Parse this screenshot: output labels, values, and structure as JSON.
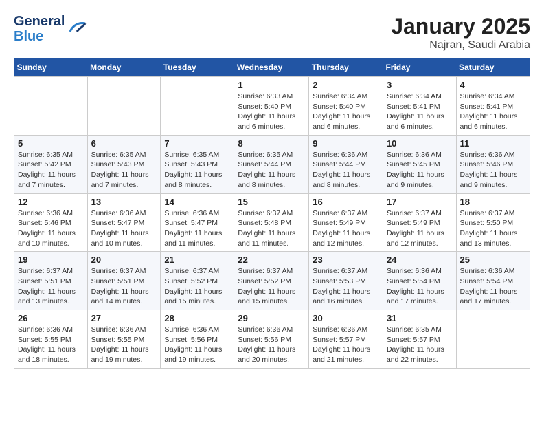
{
  "logo": {
    "line1": "General",
    "line2": "Blue"
  },
  "title": "January 2025",
  "subtitle": "Najran, Saudi Arabia",
  "weekdays": [
    "Sunday",
    "Monday",
    "Tuesday",
    "Wednesday",
    "Thursday",
    "Friday",
    "Saturday"
  ],
  "weeks": [
    [
      {
        "num": "",
        "info": ""
      },
      {
        "num": "",
        "info": ""
      },
      {
        "num": "",
        "info": ""
      },
      {
        "num": "1",
        "info": "Sunrise: 6:33 AM\nSunset: 5:40 PM\nDaylight: 11 hours\nand 6 minutes."
      },
      {
        "num": "2",
        "info": "Sunrise: 6:34 AM\nSunset: 5:40 PM\nDaylight: 11 hours\nand 6 minutes."
      },
      {
        "num": "3",
        "info": "Sunrise: 6:34 AM\nSunset: 5:41 PM\nDaylight: 11 hours\nand 6 minutes."
      },
      {
        "num": "4",
        "info": "Sunrise: 6:34 AM\nSunset: 5:41 PM\nDaylight: 11 hours\nand 6 minutes."
      }
    ],
    [
      {
        "num": "5",
        "info": "Sunrise: 6:35 AM\nSunset: 5:42 PM\nDaylight: 11 hours\nand 7 minutes."
      },
      {
        "num": "6",
        "info": "Sunrise: 6:35 AM\nSunset: 5:43 PM\nDaylight: 11 hours\nand 7 minutes."
      },
      {
        "num": "7",
        "info": "Sunrise: 6:35 AM\nSunset: 5:43 PM\nDaylight: 11 hours\nand 8 minutes."
      },
      {
        "num": "8",
        "info": "Sunrise: 6:35 AM\nSunset: 5:44 PM\nDaylight: 11 hours\nand 8 minutes."
      },
      {
        "num": "9",
        "info": "Sunrise: 6:36 AM\nSunset: 5:44 PM\nDaylight: 11 hours\nand 8 minutes."
      },
      {
        "num": "10",
        "info": "Sunrise: 6:36 AM\nSunset: 5:45 PM\nDaylight: 11 hours\nand 9 minutes."
      },
      {
        "num": "11",
        "info": "Sunrise: 6:36 AM\nSunset: 5:46 PM\nDaylight: 11 hours\nand 9 minutes."
      }
    ],
    [
      {
        "num": "12",
        "info": "Sunrise: 6:36 AM\nSunset: 5:46 PM\nDaylight: 11 hours\nand 10 minutes."
      },
      {
        "num": "13",
        "info": "Sunrise: 6:36 AM\nSunset: 5:47 PM\nDaylight: 11 hours\nand 10 minutes."
      },
      {
        "num": "14",
        "info": "Sunrise: 6:36 AM\nSunset: 5:47 PM\nDaylight: 11 hours\nand 11 minutes."
      },
      {
        "num": "15",
        "info": "Sunrise: 6:37 AM\nSunset: 5:48 PM\nDaylight: 11 hours\nand 11 minutes."
      },
      {
        "num": "16",
        "info": "Sunrise: 6:37 AM\nSunset: 5:49 PM\nDaylight: 11 hours\nand 12 minutes."
      },
      {
        "num": "17",
        "info": "Sunrise: 6:37 AM\nSunset: 5:49 PM\nDaylight: 11 hours\nand 12 minutes."
      },
      {
        "num": "18",
        "info": "Sunrise: 6:37 AM\nSunset: 5:50 PM\nDaylight: 11 hours\nand 13 minutes."
      }
    ],
    [
      {
        "num": "19",
        "info": "Sunrise: 6:37 AM\nSunset: 5:51 PM\nDaylight: 11 hours\nand 13 minutes."
      },
      {
        "num": "20",
        "info": "Sunrise: 6:37 AM\nSunset: 5:51 PM\nDaylight: 11 hours\nand 14 minutes."
      },
      {
        "num": "21",
        "info": "Sunrise: 6:37 AM\nSunset: 5:52 PM\nDaylight: 11 hours\nand 15 minutes."
      },
      {
        "num": "22",
        "info": "Sunrise: 6:37 AM\nSunset: 5:52 PM\nDaylight: 11 hours\nand 15 minutes."
      },
      {
        "num": "23",
        "info": "Sunrise: 6:37 AM\nSunset: 5:53 PM\nDaylight: 11 hours\nand 16 minutes."
      },
      {
        "num": "24",
        "info": "Sunrise: 6:36 AM\nSunset: 5:54 PM\nDaylight: 11 hours\nand 17 minutes."
      },
      {
        "num": "25",
        "info": "Sunrise: 6:36 AM\nSunset: 5:54 PM\nDaylight: 11 hours\nand 17 minutes."
      }
    ],
    [
      {
        "num": "26",
        "info": "Sunrise: 6:36 AM\nSunset: 5:55 PM\nDaylight: 11 hours\nand 18 minutes."
      },
      {
        "num": "27",
        "info": "Sunrise: 6:36 AM\nSunset: 5:55 PM\nDaylight: 11 hours\nand 19 minutes."
      },
      {
        "num": "28",
        "info": "Sunrise: 6:36 AM\nSunset: 5:56 PM\nDaylight: 11 hours\nand 19 minutes."
      },
      {
        "num": "29",
        "info": "Sunrise: 6:36 AM\nSunset: 5:56 PM\nDaylight: 11 hours\nand 20 minutes."
      },
      {
        "num": "30",
        "info": "Sunrise: 6:36 AM\nSunset: 5:57 PM\nDaylight: 11 hours\nand 21 minutes."
      },
      {
        "num": "31",
        "info": "Sunrise: 6:35 AM\nSunset: 5:57 PM\nDaylight: 11 hours\nand 22 minutes."
      },
      {
        "num": "",
        "info": ""
      }
    ]
  ]
}
